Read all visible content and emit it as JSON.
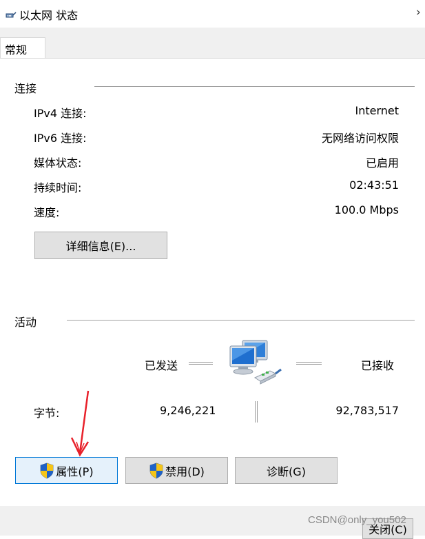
{
  "window": {
    "title": "以太网 状态",
    "chevron": "›"
  },
  "tabs": [
    {
      "label": "常规"
    }
  ],
  "connection": {
    "group_title": "连接",
    "rows": [
      {
        "label": "IPv4 连接:",
        "value": "Internet"
      },
      {
        "label": "IPv6 连接:",
        "value": "无网络访问权限"
      },
      {
        "label": "媒体状态:",
        "value": "已启用"
      },
      {
        "label": "持续时间:",
        "value": "02:43:51"
      },
      {
        "label": "速度:",
        "value": "100.0 Mbps"
      }
    ],
    "details_button": "详细信息(E)..."
  },
  "activity": {
    "group_title": "活动",
    "sent_label": "已发送",
    "received_label": "已接收",
    "bytes_label": "字节:",
    "bytes_sent": "9,246,221",
    "bytes_received": "92,783,517"
  },
  "buttons": {
    "properties": "属性(P)",
    "disable": "禁用(D)",
    "diagnose": "诊断(G)",
    "close": "关闭(C)"
  },
  "watermark": "CSDN@only_you502",
  "icons": {
    "title": "ethernet-icon",
    "network": "network-computers-icon",
    "shield": "uac-shield-icon",
    "annotation": "red-arrow-icon"
  },
  "colors": {
    "primary_button_border": "#0078d7",
    "primary_button_bg": "#e5f1fb",
    "arrow": "#e8202a"
  }
}
